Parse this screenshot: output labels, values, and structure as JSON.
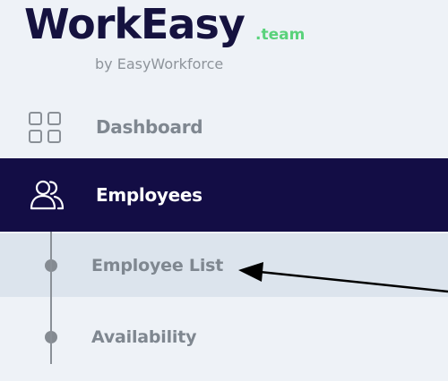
{
  "brand": {
    "name": "WorkEasy",
    "suffix": ".team",
    "byline": "by EasyWorkforce"
  },
  "nav": {
    "items": [
      {
        "label": "Dashboard",
        "icon": "grid-icon",
        "active": false
      },
      {
        "label": "Employees",
        "icon": "users-icon",
        "active": true
      }
    ],
    "sub_items": [
      {
        "label": "Employee List",
        "highlighted": true
      },
      {
        "label": "Availability",
        "highlighted": false
      }
    ]
  },
  "colors": {
    "sidebar_bg": "#eef2f7",
    "active_bg": "#130d45",
    "active_text": "#ffffff",
    "muted_text": "#7f8790",
    "brand_dark": "#15123f",
    "brand_accent": "#5ad27b",
    "subitem_highlight": "#dce4ed"
  }
}
